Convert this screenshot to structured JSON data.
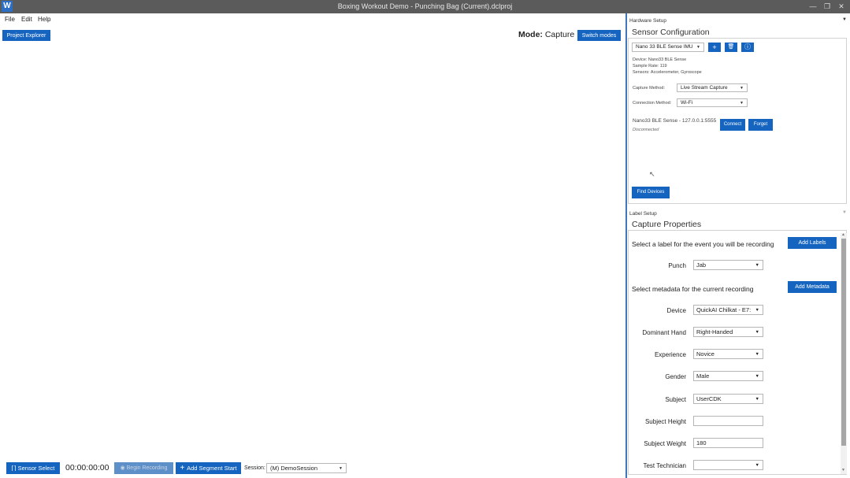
{
  "window": {
    "title": "Boxing Workout Demo - Punching Bag (Current).dclproj",
    "icon": "app-logo-icon",
    "controls": [
      "minimize-icon",
      "restore-icon",
      "close-icon"
    ]
  },
  "menu": {
    "items": [
      "File",
      "Edit",
      "Help"
    ]
  },
  "toolbar": {
    "project_explorer": "Project Explorer",
    "mode_label": "Mode:",
    "mode_value": "Capture",
    "switch_modes": "Switch modes"
  },
  "hardware": {
    "header": "Hardware Setup",
    "title": "Sensor Configuration",
    "sensor_select": "Nano 33 BLE Sense IMU",
    "info_lines": [
      "Device: Nano33 BLE Sense",
      "Sample Rate: 119",
      "Sensors: Accelerometer, Gyroscope"
    ],
    "capture_method_label": "Capture Method:",
    "capture_method_value": "Live Stream Capture",
    "connection_method_label": "Connection Method:",
    "connection_method_value": "Wi-Fi",
    "device_name": "Nano33 BLE Sense - 127.0.0.1:5555",
    "device_status": "Disconnected",
    "connect": "Connect",
    "forget": "Forget",
    "find_devices": "Find Devices"
  },
  "label_setup": {
    "header": "Label Setup",
    "title": "Capture Properties",
    "label_prompt": "Select a label for the event you will be recording",
    "add_labels": "Add Labels",
    "punch_label": "Punch",
    "punch_value": "Jab",
    "metadata_prompt": "Select metadata for the current recording",
    "add_metadata": "Add Metadata",
    "fields": [
      {
        "label": "Device",
        "value": "QuickAI Chilkat - E7:",
        "kind": "dropdown"
      },
      {
        "label": "Dominant Hand",
        "value": "Right-Handed",
        "kind": "dropdown"
      },
      {
        "label": "Experience",
        "value": "Novice",
        "kind": "dropdown"
      },
      {
        "label": "Gender",
        "value": "Male",
        "kind": "dropdown"
      },
      {
        "label": "Subject",
        "value": "UserCDK",
        "kind": "dropdown"
      },
      {
        "label": "Subject Height",
        "value": "",
        "kind": "input"
      },
      {
        "label": "Subject Weight",
        "value": "180",
        "kind": "input"
      },
      {
        "label": "Test Technician",
        "value": "",
        "kind": "dropdown"
      }
    ]
  },
  "bottom": {
    "sensor_select": "Sensor Select",
    "timer": "00:00:00:00",
    "begin_recording": "Begin Recording",
    "add_segment": "Add Segment Start",
    "session_label": "Session:",
    "session_value": "(M) DemoSession"
  }
}
